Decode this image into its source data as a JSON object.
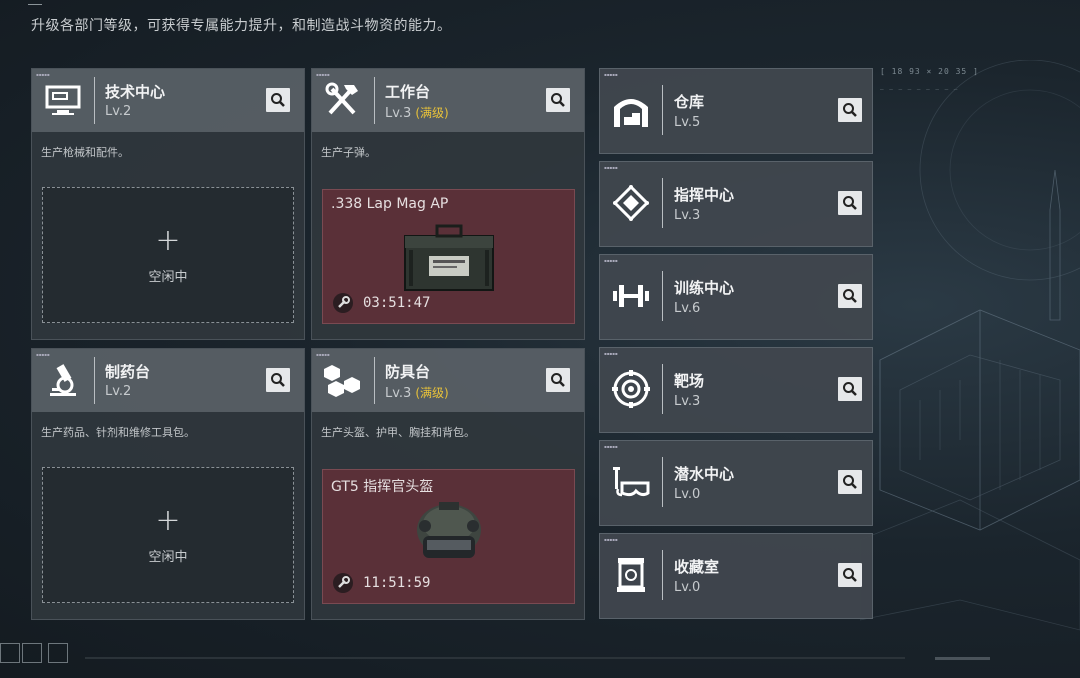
{
  "intro": "升级各部门等级，可获得专属能力提升，和制造战斗物资的能力。",
  "coords": "[ 18 93 × 20 35 ]",
  "idle_label": "空闲中",
  "plus": "+",
  "cards": [
    {
      "name": "技术中心",
      "level": "Lv.2",
      "maxed": "",
      "desc": "生产枪械和配件。",
      "icon": "monitor-icon",
      "state": "idle"
    },
    {
      "name": "工作台",
      "level": "Lv.3",
      "maxed": "(满级)",
      "desc": "生产子弹。",
      "icon": "hammer-wrench-icon",
      "state": "producing",
      "product": ".338 Lap Mag AP",
      "time": "03:51:47",
      "product_image": "ammo-box-image"
    },
    {
      "name": "制药台",
      "level": "Lv.2",
      "maxed": "",
      "desc": "生产药品、针剂和维修工具包。",
      "icon": "microscope-icon",
      "state": "idle"
    },
    {
      "name": "防具台",
      "level": "Lv.3",
      "maxed": "(满级)",
      "desc": "生产头盔、护甲、胸挂和背包。",
      "icon": "cubes-icon",
      "state": "producing",
      "product": "GT5 指挥官头盔",
      "time": "11:51:59",
      "product_image": "helmet-image"
    }
  ],
  "side": [
    {
      "name": "仓库",
      "level": "Lv.5",
      "icon": "warehouse-icon"
    },
    {
      "name": "指挥中心",
      "level": "Lv.3",
      "icon": "command-chip-icon"
    },
    {
      "name": "训练中心",
      "level": "Lv.6",
      "icon": "dumbbell-icon"
    },
    {
      "name": "靶场",
      "level": "Lv.3",
      "icon": "target-icon"
    },
    {
      "name": "潜水中心",
      "level": "Lv.0",
      "icon": "diving-mask-icon"
    },
    {
      "name": "收藏室",
      "level": "Lv.0",
      "icon": "display-case-icon"
    }
  ],
  "colors": {
    "accent_max": "#e8c23a",
    "production_bg": "#5a3038",
    "header_bg": "#5c636a"
  }
}
